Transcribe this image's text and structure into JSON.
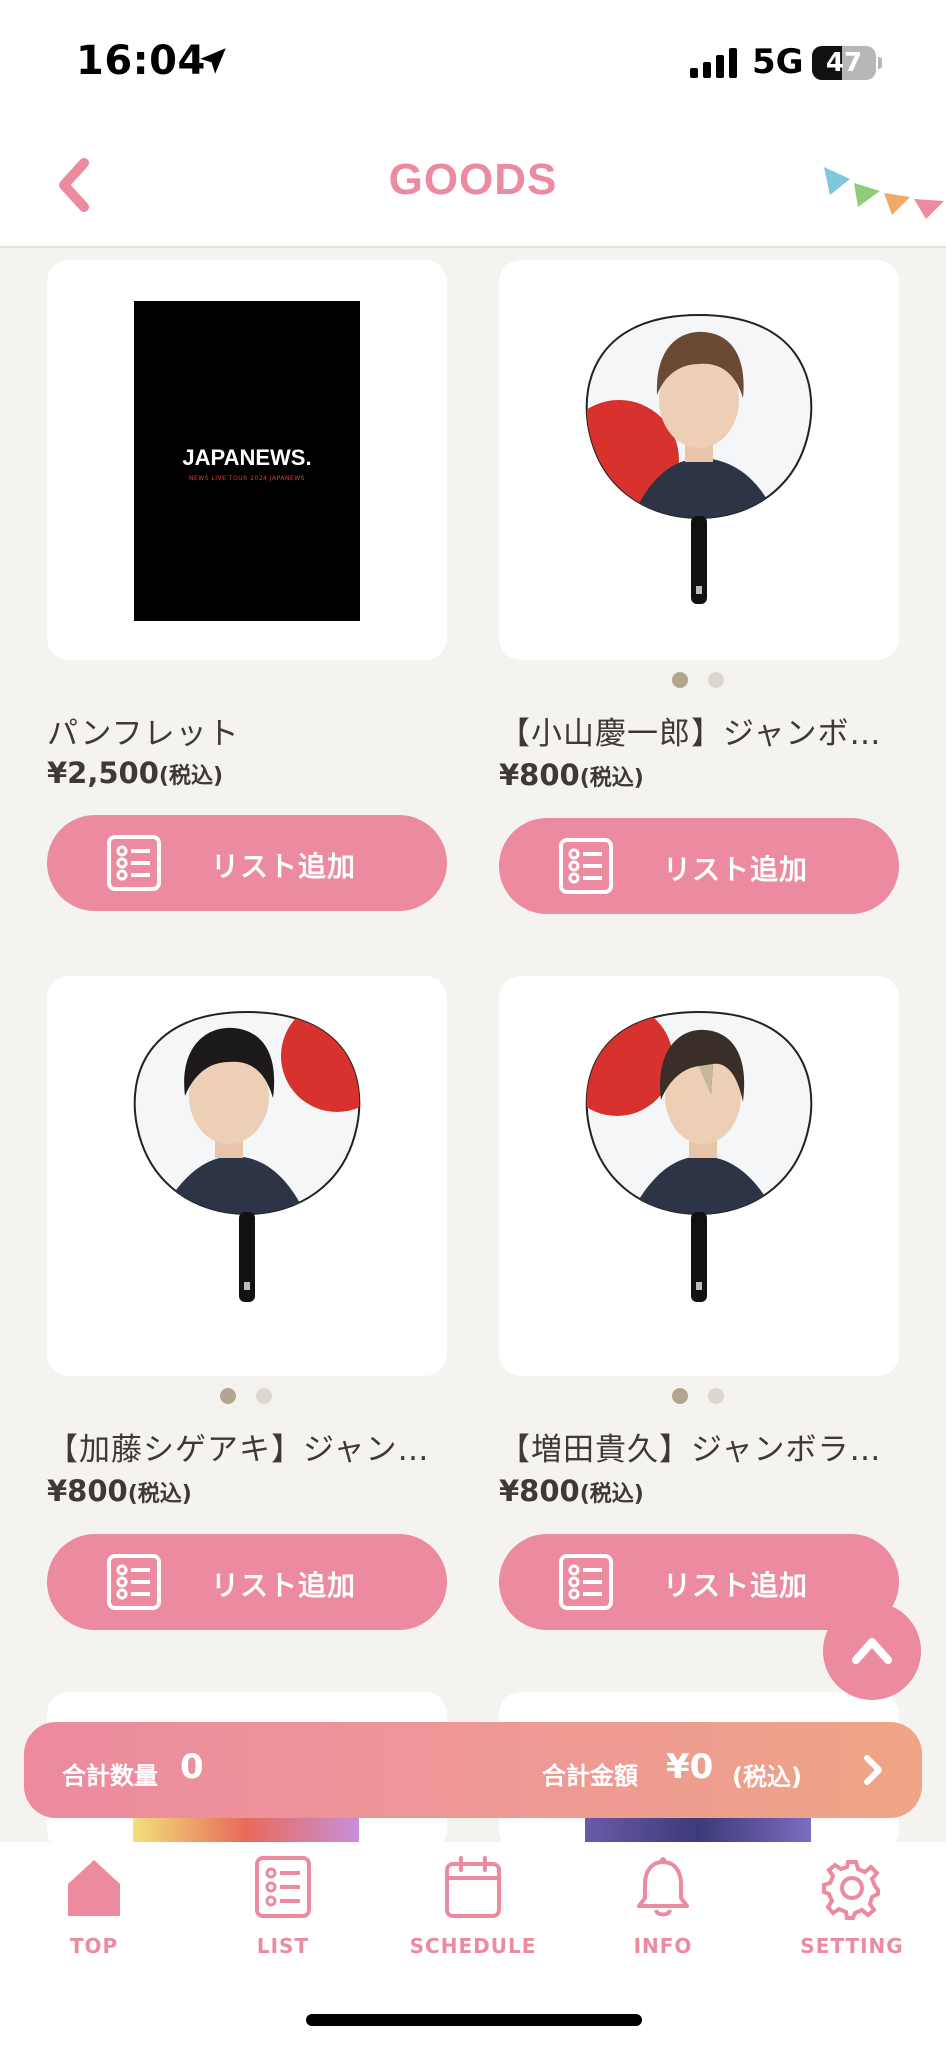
{
  "status_bar": {
    "time": "16:04",
    "network": "5G",
    "battery": "47",
    "battery_level": 0.47
  },
  "header": {
    "title": "GOODS"
  },
  "products": [
    {
      "name": "パンフレット",
      "price": "¥2,500",
      "tax": "(税込)",
      "button_label": "リスト追加",
      "image_text": "JAPANEWS.",
      "image_subtext": "NEWS LIVE TOUR 2024 JAPANEWS"
    },
    {
      "name": "【小山慶一郎】ジャンボ…",
      "price": "¥800",
      "tax": "(税込)",
      "button_label": "リスト追加"
    },
    {
      "name": "【加藤シゲアキ】ジャン…",
      "price": "¥800",
      "tax": "(税込)",
      "button_label": "リスト追加"
    },
    {
      "name": "【増田貴久】ジャンボラ…",
      "price": "¥800",
      "tax": "(税込)",
      "button_label": "リスト追加"
    }
  ],
  "totals": {
    "quantity_label": "合計数量",
    "quantity": "0",
    "amount_label": "合計金額",
    "amount": "¥0",
    "amount_tax": "(税込)"
  },
  "tabs": [
    {
      "label": "TOP",
      "icon": "home-icon"
    },
    {
      "label": "LIST",
      "icon": "list-icon"
    },
    {
      "label": "SCHEDULE",
      "icon": "calendar-icon"
    },
    {
      "label": "INFO",
      "icon": "bell-icon"
    },
    {
      "label": "SETTING",
      "icon": "gear-icon"
    }
  ],
  "colors": {
    "accent": "#ec8a9f",
    "background": "#f5f3ef",
    "text": "#3d3a36"
  }
}
